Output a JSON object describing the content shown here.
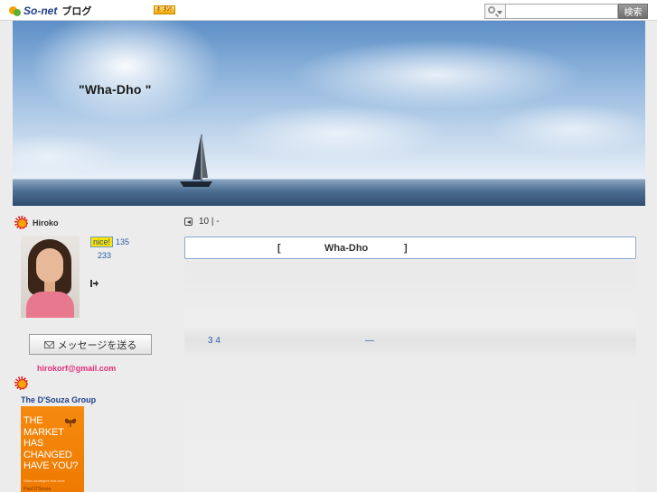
{
  "topbar": {
    "logo_text": "So-net",
    "logo_suffix": "ブログ",
    "promo_label": "ﾎﾞﾀﾝ!",
    "search_placeholder": "",
    "search_button": "検索"
  },
  "header": {
    "blog_title": "\"Wha-Dho        \""
  },
  "sidebar": {
    "author_name": "Hiroko",
    "nice_label": "nice!",
    "nice_count": "135",
    "second_count": "233",
    "message_button": "メッセージを送る",
    "email": "hirokorf@gmail.com",
    "book_section_title": "The D'Souza Group",
    "book_cover_text": "THE\nMARKET\nHAS\nCHANGED\nHAVE YOU?",
    "book_cover_subtitle": "Sales strategies that work",
    "book_cover_author": "Paul D'Souza"
  },
  "main": {
    "nav_text": "10  | -",
    "post_title_open": "[",
    "post_title_name": "Wha-Dho",
    "post_title_close": "]",
    "post_line": "3  4",
    "post_dash": "—"
  },
  "colors": {
    "link": "#2a5ea8",
    "email": "#e0307a",
    "title_border": "#8aa9d2",
    "book_cover": "#f58a10"
  }
}
